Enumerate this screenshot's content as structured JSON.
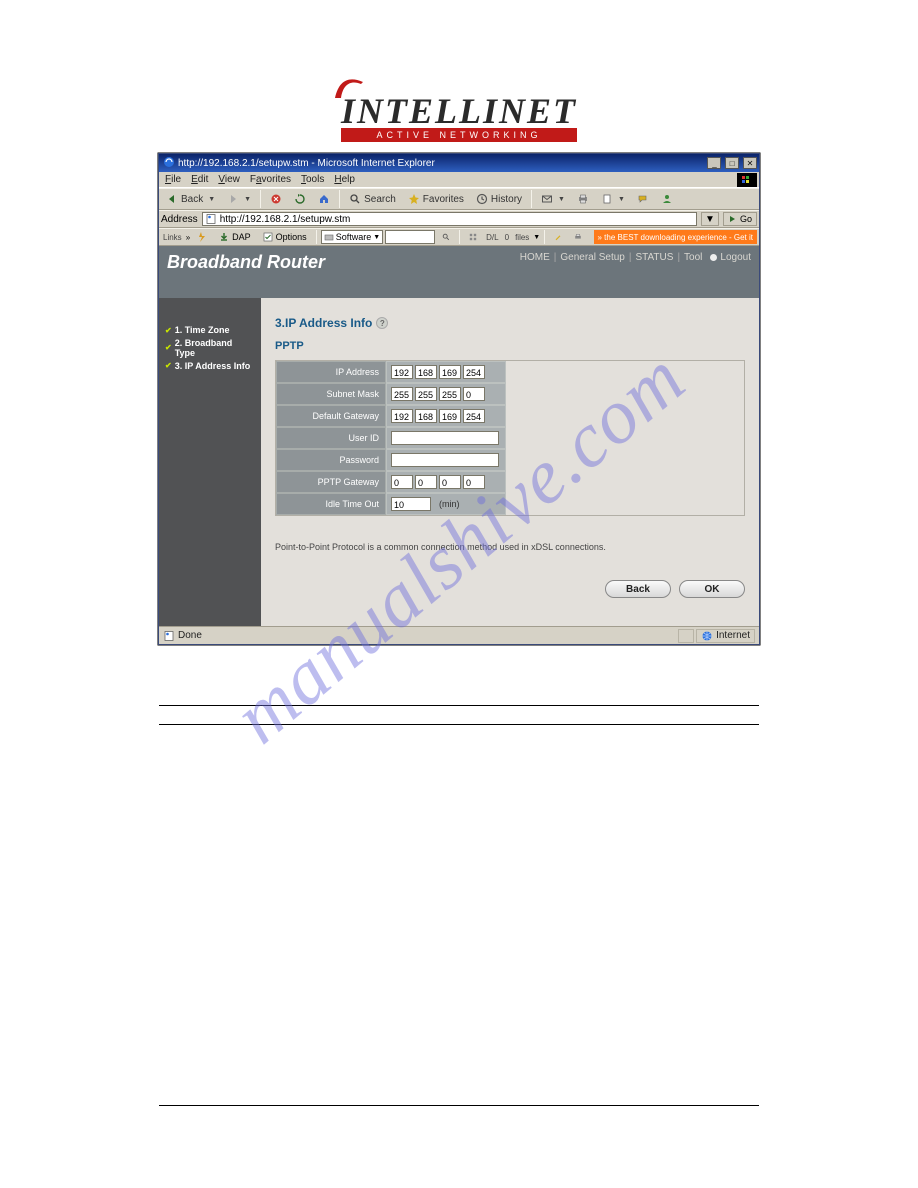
{
  "logo": {
    "text": "INTELLINET",
    "tagline": "ACTIVE NETWORKING"
  },
  "window": {
    "title": "http://192.168.2.1/setupw.stm - Microsoft Internet Explorer",
    "menus": {
      "file": "File",
      "edit": "Edit",
      "view": "View",
      "favorites": "Favorites",
      "tools": "Tools",
      "help": "Help"
    },
    "toolbar": {
      "back": "Back",
      "search": "Search",
      "favorites": "Favorites",
      "history": "History"
    },
    "address": {
      "label": "Address",
      "url": "http://192.168.2.1/setupw.stm",
      "go": "Go"
    },
    "linksbar": {
      "links": "Links",
      "dap": "DAP",
      "options": "Options",
      "software_label": "Software",
      "dl": "D/L",
      "dl_count": "0",
      "files": "files",
      "banner": "» the BEST downloading experience - Get it"
    },
    "statusbar": {
      "done": "Done",
      "zone": "Internet"
    }
  },
  "router": {
    "brand": "Broadband Router",
    "nav": {
      "home": "HOME",
      "general": "General Setup",
      "status": "STATUS",
      "tool": "Tool",
      "logout": "Logout"
    },
    "sidebar": {
      "items": [
        {
          "label": "1. Time Zone"
        },
        {
          "label": "2. Broadband Type"
        },
        {
          "label": "3. IP Address Info"
        }
      ]
    },
    "section": {
      "title": "3.IP Address Info",
      "protocol": "PPTP"
    },
    "form": {
      "ip_address": {
        "label": "IP Address",
        "oct": [
          "192",
          "168",
          "169",
          "254"
        ]
      },
      "subnet_mask": {
        "label": "Subnet Mask",
        "oct": [
          "255",
          "255",
          "255",
          "0"
        ]
      },
      "default_gateway": {
        "label": "Default Gateway",
        "oct": [
          "192",
          "168",
          "169",
          "254"
        ]
      },
      "user_id": {
        "label": "User ID",
        "value": ""
      },
      "password": {
        "label": "Password",
        "value": ""
      },
      "pptp_gateway": {
        "label": "PPTP Gateway",
        "oct": [
          "0",
          "0",
          "0",
          "0"
        ]
      },
      "idle_time_out": {
        "label": "Idle Time Out",
        "value": "10",
        "unit": "(min)"
      }
    },
    "description": "Point-to-Point Protocol is a common connection method used in xDSL connections.",
    "buttons": {
      "back": "Back",
      "ok": "OK"
    }
  },
  "watermark": "manualshive.com"
}
